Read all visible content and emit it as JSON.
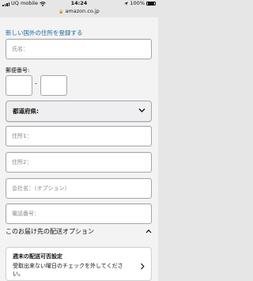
{
  "status_bar": {
    "carrier": "UQ mobile",
    "time": "14:24",
    "battery_percent": "100%",
    "battery_level": 1.0
  },
  "browser": {
    "url": "amazon.co.jp"
  },
  "form": {
    "register_link": "新しい国外の住所を登録する",
    "name_placeholder": "氏名：",
    "postal_label": "郵便番号:",
    "postal_separator": "-",
    "prefecture_label": "都道府県:",
    "address1_placeholder": "住所1：",
    "address2_placeholder": "住所2：",
    "company_placeholder": "会社名：（オプション）",
    "phone_placeholder": "電話番号："
  },
  "delivery_options": {
    "header": "このお届け先の配送オプション",
    "card_title": "週末の配送可否設定",
    "card_description": "受取出来ない曜日のチェックを外してください。"
  },
  "colors": {
    "link": "#1c6a9c",
    "page_background": "#f3f3f3"
  }
}
